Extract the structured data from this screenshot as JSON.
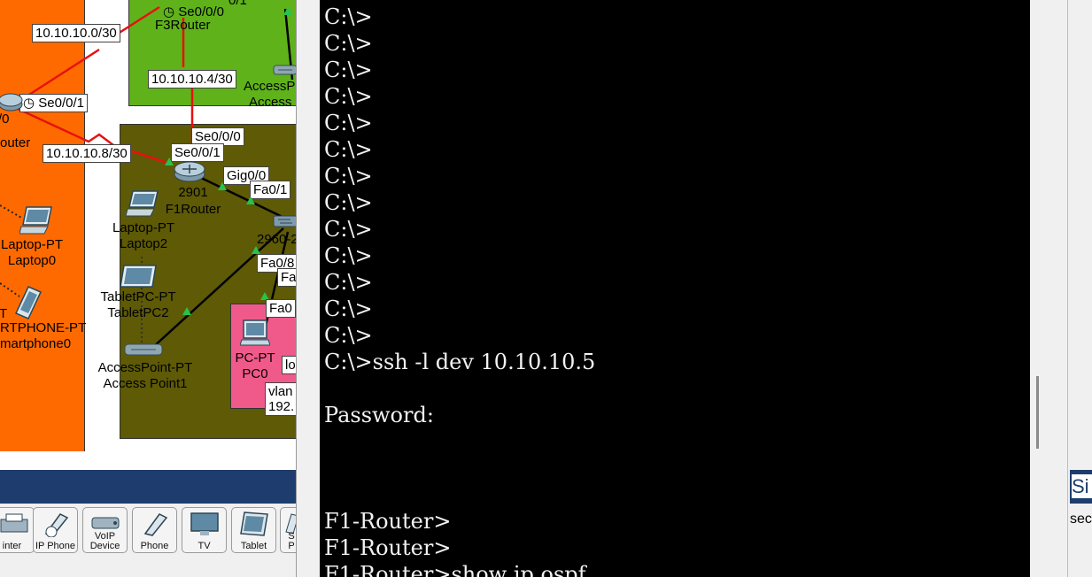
{
  "topology": {
    "networks": {
      "f3_link": "10.10.10.0/30",
      "f3_f1_link": "10.10.10.4/30",
      "left_link": "10.10.10.8/30"
    },
    "ports": {
      "f3_se000": "Se0/0/0",
      "f3_top_partial": "0/1",
      "left_se001": "Se0/0/1",
      "left_partial": "/0",
      "f1_se000": "Se0/0/0",
      "f1_se001": "Se0/0/1",
      "f1_gig": "Gig0/0",
      "sw_fa01": "Fa0/1",
      "sw_fa08": "Fa0/8",
      "sw_fa_partial": "Fa",
      "pc_fa0": "Fa0"
    },
    "devices": {
      "f3_router": "F3Router",
      "left_router": "outer",
      "f1_model": "2901",
      "f1_name": "F1Router",
      "ap_top_type": "AccessP",
      "ap_top_name": "Access",
      "laptop0_type": "Laptop-PT",
      "laptop0_name": "Laptop0",
      "smartphone_type": "RTPHONE-PT",
      "smartphone_name": "martphone0",
      "smartphone_prefix": "T",
      "laptop2_type": "Laptop-PT",
      "laptop2_name": "Laptop2",
      "tablet_type": "TabletPC-PT",
      "tablet_name": "TabletPC2",
      "ap1_type": "AccessPoint-PT",
      "ap1_name": "Access Point1",
      "switch_model": "2960-2",
      "pc_type": "PC-PT",
      "pc_name": "PC0",
      "pc_note_1": "lo",
      "pc_note_2": "vlan",
      "pc_note_3": "192."
    }
  },
  "device_bar": {
    "items": [
      {
        "label": "inter",
        "icon": "printer-icon"
      },
      {
        "label": "IP Phone",
        "icon": "ip-phone-icon"
      },
      {
        "label": "VoIP\nDevice",
        "icon": "voip-device-icon"
      },
      {
        "label": "Phone",
        "icon": "phone-icon"
      },
      {
        "label": "TV",
        "icon": "tv-icon"
      },
      {
        "label": "Tablet",
        "icon": "tablet-icon"
      },
      {
        "label": "S\nP",
        "icon": "smartphone-icon"
      }
    ]
  },
  "terminal": {
    "lines": [
      "C:\\>",
      "C:\\>",
      "C:\\>",
      "C:\\>",
      "C:\\>",
      "C:\\>",
      "C:\\>",
      "C:\\>",
      "C:\\>",
      "C:\\>",
      "C:\\>",
      "C:\\>",
      "C:\\>",
      "C:\\>ssh -l dev 10.10.10.5",
      "",
      "Password:",
      "",
      "",
      "",
      "F1-Router>",
      "F1-Router>",
      "F1-Router>show ip ospf"
    ]
  },
  "right_panel": {
    "header": "Si",
    "subtext": "sec"
  },
  "colors": {
    "left_area": "#ff6a00",
    "f3_area": "#5fb21a",
    "f1_area": "#5e5a06",
    "pc_area": "#f05a8a",
    "serial_link": "#e81010",
    "bar": "#1e3c6d",
    "terminal_bg": "#000000",
    "terminal_text": "#f2f2f2"
  }
}
